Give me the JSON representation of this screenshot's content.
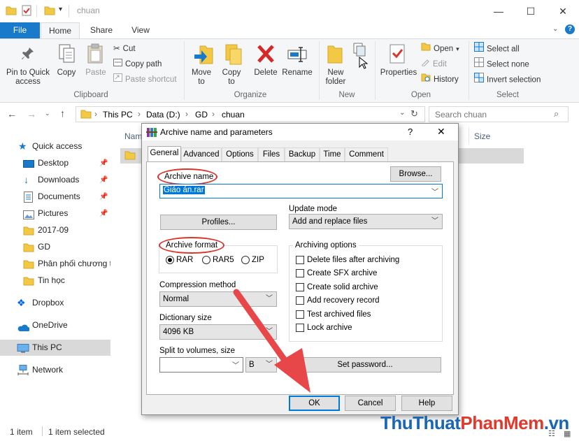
{
  "window": {
    "title": "chuan"
  },
  "ribbon_tabs": [
    {
      "label": "File"
    },
    {
      "label": "Home"
    },
    {
      "label": "Share"
    },
    {
      "label": "View"
    }
  ],
  "clipboard": {
    "pin_label": "Pin to Quick access",
    "copy_label": "Copy",
    "paste_label": "Paste",
    "cut_label": "Cut",
    "copy_path_label": "Copy path",
    "paste_shortcut_label": "Paste shortcut",
    "group_label": "Clipboard"
  },
  "organize": {
    "move_label": "Move to",
    "copyto_label": "Copy to",
    "delete_label": "Delete",
    "rename_label": "Rename",
    "group_label": "Organize"
  },
  "new_group": {
    "new_folder_label": "New folder",
    "group_label": "New"
  },
  "open_group": {
    "properties_label": "Properties",
    "open_label": "Open",
    "edit_label": "Edit",
    "history_label": "History",
    "group_label": "Open"
  },
  "select_group": {
    "select_all_label": "Select all",
    "select_none_label": "Select none",
    "invert_label": "Invert selection",
    "group_label": "Select"
  },
  "address": {
    "crumbs": [
      "This PC",
      "Data (D:)",
      "GD",
      "chuan"
    ],
    "search_placeholder": "Search chuan"
  },
  "columns": {
    "name": "Nam",
    "size": "Size"
  },
  "nav": {
    "quick_access": "Quick access",
    "items": [
      {
        "label": "Desktop"
      },
      {
        "label": "Downloads"
      },
      {
        "label": "Documents"
      },
      {
        "label": "Pictures"
      },
      {
        "label": "2017-09"
      },
      {
        "label": "GD"
      },
      {
        "label": "Phân phối chương t"
      },
      {
        "label": "Tin học"
      }
    ],
    "dropbox": "Dropbox",
    "onedrive": "OneDrive",
    "thispc": "This PC",
    "network": "Network"
  },
  "status": {
    "count": "1 item",
    "selected": "1 item selected"
  },
  "dialog": {
    "title": "Archive name and parameters",
    "help_glyph": "?",
    "tabs": [
      {
        "label": "General"
      },
      {
        "label": "Advanced"
      },
      {
        "label": "Options"
      },
      {
        "label": "Files"
      },
      {
        "label": "Backup"
      },
      {
        "label": "Time"
      },
      {
        "label": "Comment"
      }
    ],
    "archive_name_label": "Archive name",
    "browse_label": "Browse...",
    "archive_name_value": "Giáo án.rar",
    "profiles_label": "Profiles...",
    "update_mode_label": "Update mode",
    "update_mode_value": "Add and replace files",
    "archive_format_label": "Archive format",
    "formats": [
      {
        "label": "RAR",
        "selected": true
      },
      {
        "label": "RAR5",
        "selected": false
      },
      {
        "label": "ZIP",
        "selected": false
      }
    ],
    "archiving_options_label": "Archiving options",
    "options": [
      {
        "label": "Delete files after archiving"
      },
      {
        "label": "Create SFX archive"
      },
      {
        "label": "Create solid archive"
      },
      {
        "label": "Add recovery record"
      },
      {
        "label": "Test archived files"
      },
      {
        "label": "Lock archive"
      }
    ],
    "compression_label": "Compression method",
    "compression_value": "Normal",
    "dictionary_label": "Dictionary size",
    "dictionary_value": "4096 KB",
    "split_label": "Split to volumes, size",
    "split_unit": "B",
    "set_password_label": "Set password...",
    "ok_label": "OK",
    "cancel_label": "Cancel",
    "help_label": "Help"
  },
  "watermark": {
    "part1": "Thu",
    "part2": "Thuat",
    "part3": "PhanMem",
    "part4": ".vn"
  },
  "colors": {
    "accent": "#1979ca",
    "highlight": "#d9342b",
    "selection": "#cce8ff"
  }
}
